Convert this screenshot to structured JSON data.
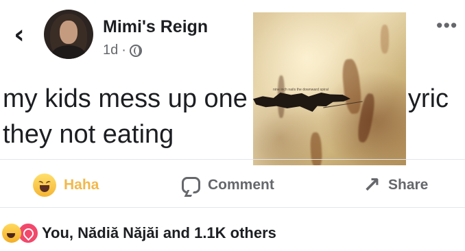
{
  "header": {
    "back_icon": "chevron-left-icon",
    "author": "Mimi's Reign",
    "time": "1d",
    "separator": "·",
    "privacy_icon": "globe-icon",
    "more_icon": "more-horizontal-icon"
  },
  "post": {
    "text_line_1": "my kids mess up one",
    "text_line_1_end": "yric",
    "text_line_2": "they not eating"
  },
  "album_overlay": {
    "caption": "nine inch nails  the downward spiral"
  },
  "actions": {
    "haha": "Haha",
    "comment": "Comment",
    "share": "Share"
  },
  "reactions": {
    "summary": "You, Nădiă Năjăi and 1.1K others"
  },
  "colors": {
    "text": "#1c1e21",
    "secondary": "#65676b",
    "haha": "#f2b84b",
    "love": "#f2486b"
  }
}
